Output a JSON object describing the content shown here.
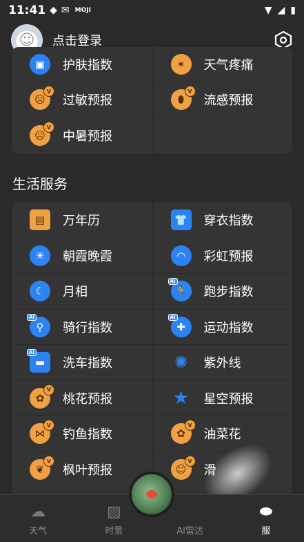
{
  "status": {
    "time": "11:41",
    "app_label": "MOJI"
  },
  "header": {
    "login": "点击登录"
  },
  "health": {
    "rows": [
      [
        {
          "label": "护肤指数",
          "icon": "skincare-icon"
        },
        {
          "label": "天气疼痛",
          "icon": "pain-icon"
        }
      ],
      [
        {
          "label": "过敏预报",
          "icon": "allergy-icon"
        },
        {
          "label": "流感预报",
          "icon": "flu-icon"
        }
      ],
      [
        {
          "label": "中暑预报",
          "icon": "heatstroke-icon"
        }
      ]
    ]
  },
  "section_title": "生活服务",
  "life": {
    "rows": [
      [
        {
          "label": "万年历"
        },
        {
          "label": "穿衣指数"
        }
      ],
      [
        {
          "label": "朝霞晚霞"
        },
        {
          "label": "彩虹预报"
        }
      ],
      [
        {
          "label": "月相"
        },
        {
          "label": "跑步指数"
        }
      ],
      [
        {
          "label": "骑行指数"
        },
        {
          "label": "运动指数"
        }
      ],
      [
        {
          "label": "洗车指数"
        },
        {
          "label": "紫外线"
        }
      ],
      [
        {
          "label": "桃花预报"
        },
        {
          "label": "星空预报"
        }
      ],
      [
        {
          "label": "钓鱼指数"
        },
        {
          "label": "油菜花"
        }
      ],
      [
        {
          "label": "枫叶预报"
        },
        {
          "label": "滑"
        }
      ]
    ]
  },
  "tabs": {
    "weather": "天气",
    "scene": "时景",
    "radar": "AI雷达",
    "services": "服"
  },
  "colors": {
    "accent_blue": "#2c84f4",
    "accent_orange": "#f0a144",
    "background": "#2b2a2a"
  }
}
